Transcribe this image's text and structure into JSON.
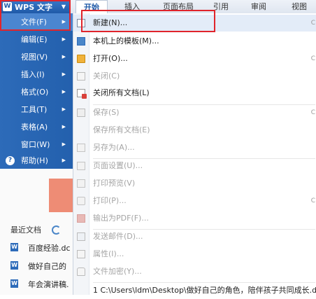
{
  "app": {
    "wps_button_label": "WPS 文字",
    "wps_logo": "W"
  },
  "ribbon_tabs": [
    {
      "label": "开始",
      "active": true
    },
    {
      "label": "插入",
      "active": false
    },
    {
      "label": "页面布局",
      "active": false
    },
    {
      "label": "引用",
      "active": false
    },
    {
      "label": "审阅",
      "active": false
    },
    {
      "label": "视图",
      "active": false
    }
  ],
  "main_menu": [
    {
      "label": "文件(F)",
      "has_submenu": true,
      "selected": true
    },
    {
      "label": "编辑(E)",
      "has_submenu": true
    },
    {
      "label": "视图(V)",
      "has_submenu": true
    },
    {
      "label": "插入(I)",
      "has_submenu": true
    },
    {
      "label": "格式(O)",
      "has_submenu": true
    },
    {
      "label": "工具(T)",
      "has_submenu": true
    },
    {
      "label": "表格(A)",
      "has_submenu": true
    },
    {
      "label": "窗口(W)",
      "has_submenu": true
    },
    {
      "label": "帮助(H)",
      "has_submenu": true
    }
  ],
  "file_submenu": [
    {
      "label": "新建(N)...",
      "icon": "new-document-icon",
      "enabled": true,
      "shortcut": "C"
    },
    {
      "label": "本机上的模板(M)...",
      "icon": "template-icon",
      "enabled": true
    },
    {
      "label": "打开(O)...",
      "icon": "open-folder-icon",
      "enabled": true,
      "shortcut": "C"
    },
    {
      "label": "关闭(C)",
      "icon": "close-document-icon",
      "enabled": false
    },
    {
      "label": "关闭所有文档(L)",
      "icon": "close-all-icon",
      "enabled": true
    },
    {
      "label": "保存(S)",
      "icon": "save-icon",
      "enabled": false,
      "shortcut": "C"
    },
    {
      "label": "保存所有文档(E)",
      "icon": "",
      "enabled": false
    },
    {
      "label": "另存为(A)...",
      "icon": "save-as-icon",
      "enabled": false
    },
    {
      "label": "页面设置(U)...",
      "icon": "page-setup-icon",
      "enabled": false
    },
    {
      "label": "打印预览(V)",
      "icon": "print-preview-icon",
      "enabled": false
    },
    {
      "label": "打印(P)...",
      "icon": "print-icon",
      "enabled": false,
      "shortcut": "C"
    },
    {
      "label": "输出为PDF(F)...",
      "icon": "pdf-icon",
      "enabled": false
    },
    {
      "label": "发送邮件(D)...",
      "icon": "mail-icon",
      "enabled": false
    },
    {
      "label": "属性(I)...",
      "icon": "properties-icon",
      "enabled": false
    },
    {
      "label": "文件加密(Y)...",
      "icon": "encrypt-icon",
      "enabled": false
    },
    {
      "label": "1 C:\\Users\\ldm\\Desktop\\做好自己的角色，陪伴孩子共同成长.d",
      "icon": "",
      "enabled": true
    }
  ],
  "recent_docs": {
    "title": "最近文档",
    "items": [
      {
        "label": "百度经验.dc",
        "icon": "W"
      },
      {
        "label": "做好自己的",
        "icon": "W"
      },
      {
        "label": "年会演讲稿.",
        "icon": "W"
      }
    ]
  },
  "colors": {
    "highlight_box": "#e0242b",
    "menu_blue": "#2360ad",
    "accent_orange": "#ee8c75"
  }
}
